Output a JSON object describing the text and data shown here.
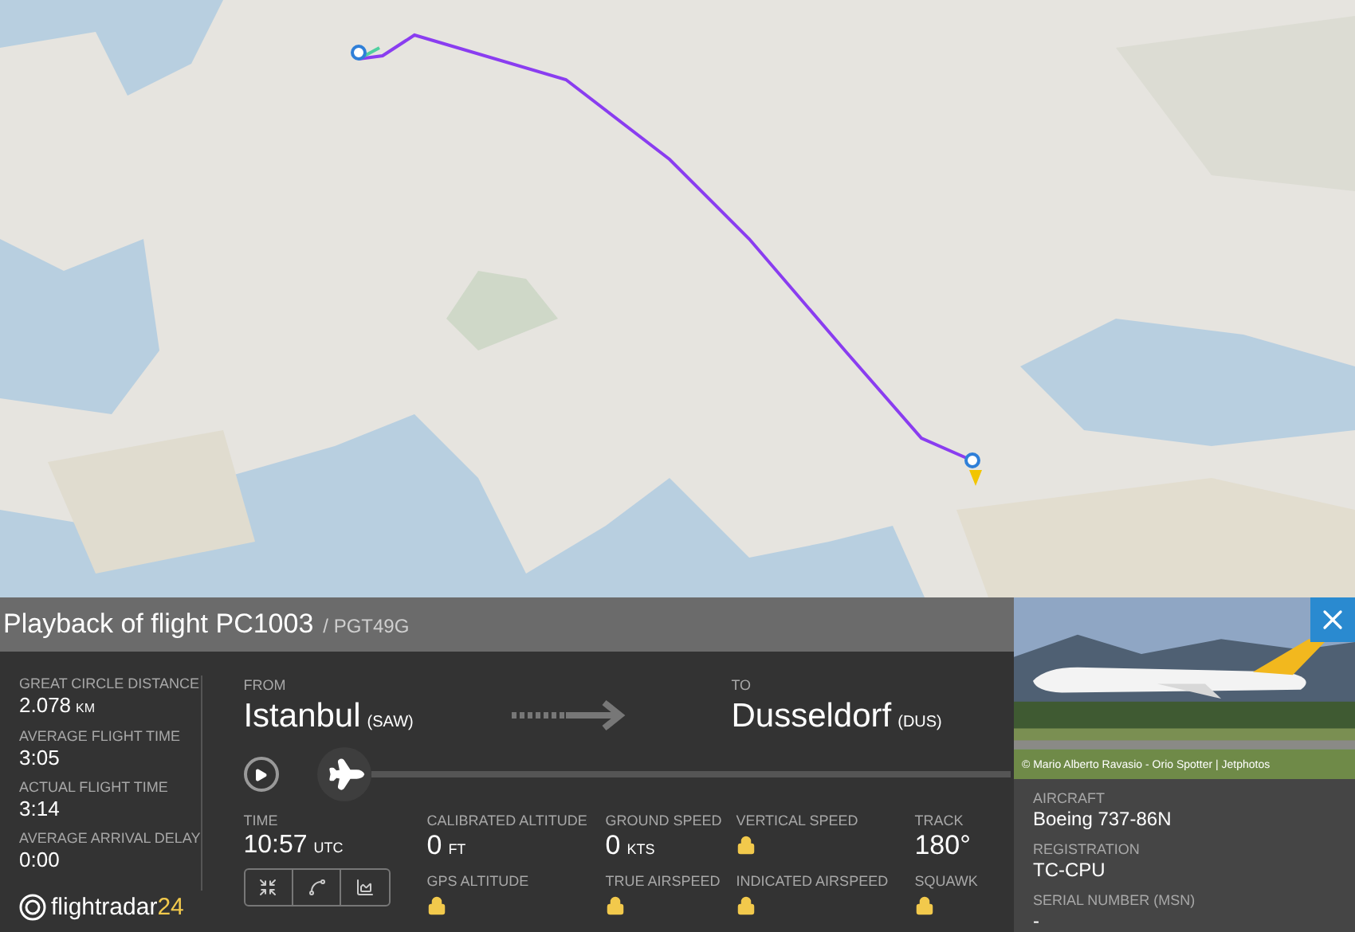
{
  "header": {
    "title": "Playback of flight PC1003",
    "callsign": "/ PGT49G"
  },
  "stats": [
    {
      "label": "GREAT CIRCLE DISTANCE",
      "value": "2.078",
      "unit": "KM"
    },
    {
      "label": "AVERAGE FLIGHT TIME",
      "value": "3:05"
    },
    {
      "label": "ACTUAL FLIGHT TIME",
      "value": "3:14"
    },
    {
      "label": "AVERAGE ARRIVAL DELAY",
      "value": "0:00"
    }
  ],
  "logo": {
    "name": "flightradar",
    "number": "24"
  },
  "route": {
    "from_label": "FROM",
    "from_city": "Istanbul",
    "from_code": "(SAW)",
    "to_label": "TO",
    "to_city": "Dusseldorf",
    "to_code": "(DUS)"
  },
  "playback": {
    "level": 0
  },
  "time": {
    "label": "TIME",
    "value": "10:57",
    "unit": "UTC"
  },
  "metrics": [
    {
      "label": "CALIBRATED ALTITUDE",
      "value": "0",
      "unit": "FT",
      "locked": false
    },
    {
      "label": "GROUND SPEED",
      "value": "0",
      "unit": "KTS",
      "locked": false
    },
    {
      "label": "VERTICAL SPEED",
      "locked": true
    },
    {
      "label": "TRACK",
      "value": "180°",
      "locked": false
    },
    {
      "label": "GPS ALTITUDE",
      "locked": true
    },
    {
      "label": "TRUE AIRSPEED",
      "locked": true
    },
    {
      "label": "INDICATED AIRSPEED",
      "locked": true
    },
    {
      "label": "SQUAWK",
      "locked": true
    }
  ],
  "photo": {
    "kind": "picture",
    "credit": "© Mario Alberto Ravasio - Orio Spotter | Jetphotos"
  },
  "aircraft": [
    {
      "label": "AIRCRAFT",
      "value": "Boeing 737-86N"
    },
    {
      "label": "REGISTRATION",
      "value": "TC-CPU"
    },
    {
      "label": "SERIAL NUMBER (MSN)",
      "value": "-"
    }
  ]
}
